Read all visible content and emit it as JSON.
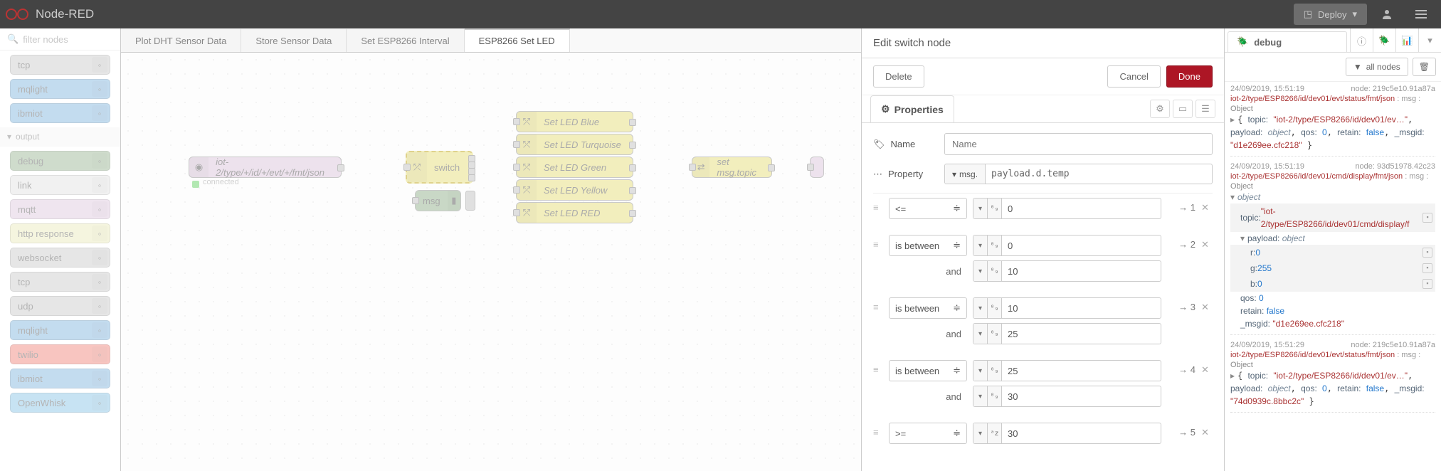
{
  "header": {
    "title": "Node-RED",
    "deploy": "Deploy"
  },
  "palette": {
    "search_placeholder": "filter nodes",
    "cat_output": "output",
    "nodes_above": [
      {
        "label": "tcp",
        "color": "#c0c0c0"
      },
      {
        "label": "mqlight",
        "color": "#6aa8d8"
      },
      {
        "label": "ibmiot",
        "color": "#6aa8d8"
      }
    ],
    "nodes_output": [
      {
        "label": "debug",
        "color": "#87a980"
      },
      {
        "label": "link",
        "color": "#dddddd"
      },
      {
        "label": "mqtt",
        "color": "#d8bfd8"
      },
      {
        "label": "http response",
        "color": "#e7e7ae"
      },
      {
        "label": "websocket",
        "color": "#c0c0c0"
      },
      {
        "label": "tcp",
        "color": "#c0c0c0"
      },
      {
        "label": "udp",
        "color": "#c0c0c0"
      },
      {
        "label": "mqlight",
        "color": "#6aa8d8"
      },
      {
        "label": "twilio",
        "color": "#ed6f63"
      },
      {
        "label": "ibmiot",
        "color": "#6aa8d8"
      },
      {
        "label": "OpenWhisk",
        "color": "#74b9e0"
      }
    ]
  },
  "tabs": [
    {
      "label": "Plot DHT Sensor Data"
    },
    {
      "label": "Store Sensor Data"
    },
    {
      "label": "Set ESP8266 Interval"
    },
    {
      "label": "ESP8266 Set LED",
      "active": true
    }
  ],
  "flow": {
    "input_node": "iot-2/type/+/id/+/evt/+/fmt/json",
    "input_status": "connected",
    "switch": "switch",
    "msg": "msg",
    "set_topic": "set msg.topic",
    "leds": [
      "Set LED Blue",
      "Set LED Turquoise",
      "Set LED Green",
      "Set LED Yellow",
      "Set LED RED"
    ]
  },
  "edit": {
    "title": "Edit switch node",
    "delete": "Delete",
    "cancel": "Cancel",
    "done": "Done",
    "properties": "Properties",
    "name_label": "Name",
    "name_placeholder": "Name",
    "property_label": "Property",
    "property_prefix": "msg.",
    "property_value": "payload.d.temp",
    "and": "and",
    "rules": [
      {
        "op": "<=",
        "v1": "0",
        "out": "→ 1"
      },
      {
        "op": "is between",
        "v1": "0",
        "v2": "10",
        "out": "→ 2"
      },
      {
        "op": "is between",
        "v1": "10",
        "v2": "25",
        "out": "→ 3"
      },
      {
        "op": "is between",
        "v1": "25",
        "v2": "30",
        "out": "→ 4"
      },
      {
        "op": ">=",
        "v1": "30",
        "out": "→ 5"
      }
    ]
  },
  "debug": {
    "title": "debug",
    "filter": "all nodes",
    "msgs": [
      {
        "time": "24/09/2019, 15:51:19",
        "node": "node: 219c5e10.91a87a",
        "topic": "iot-2/type/ESP8266/id/dev01/evt/status/fmt/json",
        "kind": "collapsed",
        "summary_topic": "\"iot-2/type/ESP8266/id/dev01/ev…\"",
        "summary_rest": "object",
        "qos": "0",
        "retain": "false",
        "msgid": "\"d1e269ee.cfc218\""
      },
      {
        "time": "24/09/2019, 15:51:19",
        "node": "node: 93d51978.42c23",
        "topic": "iot-2/type/ESP8266/id/dev01/cmd/display/fmt/json",
        "kind": "expanded",
        "exp_topic": "\"iot-2/type/ESP8266/id/dev01/cmd/display/f",
        "r": "0",
        "g": "255",
        "b": "0",
        "qos": "0",
        "retain": "false",
        "msgid": "\"d1e269ee.cfc218\""
      },
      {
        "time": "24/09/2019, 15:51:29",
        "node": "node: 219c5e10.91a87a",
        "topic": "iot-2/type/ESP8266/id/dev01/evt/status/fmt/json",
        "kind": "collapsed",
        "summary_topic": "\"iot-2/type/ESP8266/id/dev01/ev…\"",
        "summary_rest": "object",
        "qos": "0",
        "retain": "false",
        "msgid": "\"74d0939c.8bbc2c\""
      }
    ]
  },
  "label_object": "Object",
  "label_msg": "msg",
  "type_num": "⁰₉",
  "type_az": "ᵃz"
}
